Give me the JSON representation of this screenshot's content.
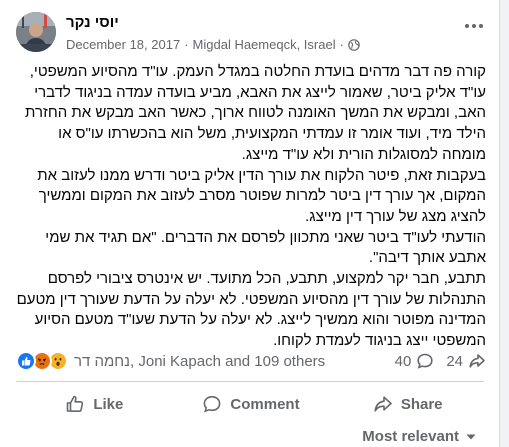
{
  "post": {
    "author": "יוסי נקר",
    "date": "December 18, 2017",
    "separator": "·",
    "location": "Migdal Haemeqck, Israel",
    "separator2": "·",
    "paragraphs": [
      "קורה פה דבר מדהים בועדת החלטה במגדל העמק. עו\"ד מהסיוע המשפטי, עו\"ד אליק ביטר, שאמור לייצג את האבא, מביע בועדה עמדה בניגוד לדברי האב, ומבקש את המשך האומנה לטווח ארוך, כאשר האב מבקש את החזרת הילד מיד, ועוד אומר זו עמדתי המקצועית, משל הוא בהכשרתו עו\"ס או מומחה למסוגלות הורית ולא עו\"ד מייצג.",
      "בעקבות זאת, פיטר הלקוח את עורך הדין אליק ביטר ודרש ממנו לעזוב את המקום, אך עורך דין ביטר למרות שפוטר מסרב לעזוב את המקום וממשיך להציג מצג של עורך דין מייצג.",
      "הודעתי לעו\"ד ביטר שאני מתכוון לפרסם את הדברים. \"אם תגיד את שמי אתבע אותך דיבה\".",
      "תתבע, חבר יקר למקצוע, תתבע, הכל מתועד. יש אינטרס ציבורי לפרסם התנהלות של עורך דין מהסיוע המשפטי. לא יעלה על הדעת שעורך דין מטעם המדינה מפוטר והוא ממשיך לייצג. לא יעלה על הדעת שעו\"ד מטעם הסיוע המשפטי ייצג בניגוד לעמדת לקוחו."
    ]
  },
  "reactions": {
    "icons": [
      "like-icon",
      "angry-icon",
      "wow-icon"
    ],
    "colors": {
      "like": "#1877f2",
      "angry": "#e9710f",
      "wow": "#f7b125"
    },
    "names_hebrew": "נחמה דר",
    "names_rest": ", Joni Kapach and 109 others",
    "comments_count": "40",
    "shares_count": "24"
  },
  "actions": {
    "like": "Like",
    "comment": "Comment",
    "share": "Share"
  },
  "sort": {
    "label": "Most relevant"
  }
}
